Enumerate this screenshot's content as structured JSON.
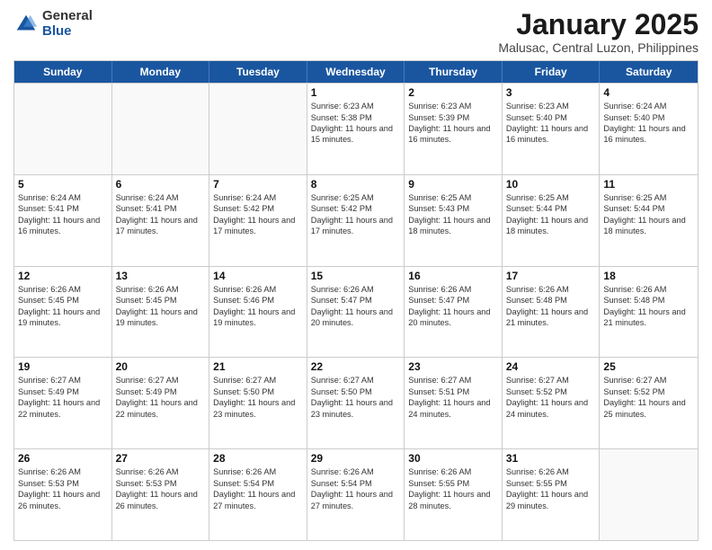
{
  "logo": {
    "general": "General",
    "blue": "Blue"
  },
  "header": {
    "month": "January 2025",
    "location": "Malusac, Central Luzon, Philippines"
  },
  "weekdays": [
    "Sunday",
    "Monday",
    "Tuesday",
    "Wednesday",
    "Thursday",
    "Friday",
    "Saturday"
  ],
  "rows": [
    [
      {
        "day": "",
        "sunrise": "",
        "sunset": "",
        "daylight": "",
        "empty": true
      },
      {
        "day": "",
        "sunrise": "",
        "sunset": "",
        "daylight": "",
        "empty": true
      },
      {
        "day": "",
        "sunrise": "",
        "sunset": "",
        "daylight": "",
        "empty": true
      },
      {
        "day": "1",
        "sunrise": "Sunrise: 6:23 AM",
        "sunset": "Sunset: 5:38 PM",
        "daylight": "Daylight: 11 hours and 15 minutes."
      },
      {
        "day": "2",
        "sunrise": "Sunrise: 6:23 AM",
        "sunset": "Sunset: 5:39 PM",
        "daylight": "Daylight: 11 hours and 16 minutes."
      },
      {
        "day": "3",
        "sunrise": "Sunrise: 6:23 AM",
        "sunset": "Sunset: 5:40 PM",
        "daylight": "Daylight: 11 hours and 16 minutes."
      },
      {
        "day": "4",
        "sunrise": "Sunrise: 6:24 AM",
        "sunset": "Sunset: 5:40 PM",
        "daylight": "Daylight: 11 hours and 16 minutes."
      }
    ],
    [
      {
        "day": "5",
        "sunrise": "Sunrise: 6:24 AM",
        "sunset": "Sunset: 5:41 PM",
        "daylight": "Daylight: 11 hours and 16 minutes."
      },
      {
        "day": "6",
        "sunrise": "Sunrise: 6:24 AM",
        "sunset": "Sunset: 5:41 PM",
        "daylight": "Daylight: 11 hours and 17 minutes."
      },
      {
        "day": "7",
        "sunrise": "Sunrise: 6:24 AM",
        "sunset": "Sunset: 5:42 PM",
        "daylight": "Daylight: 11 hours and 17 minutes."
      },
      {
        "day": "8",
        "sunrise": "Sunrise: 6:25 AM",
        "sunset": "Sunset: 5:42 PM",
        "daylight": "Daylight: 11 hours and 17 minutes."
      },
      {
        "day": "9",
        "sunrise": "Sunrise: 6:25 AM",
        "sunset": "Sunset: 5:43 PM",
        "daylight": "Daylight: 11 hours and 18 minutes."
      },
      {
        "day": "10",
        "sunrise": "Sunrise: 6:25 AM",
        "sunset": "Sunset: 5:44 PM",
        "daylight": "Daylight: 11 hours and 18 minutes."
      },
      {
        "day": "11",
        "sunrise": "Sunrise: 6:25 AM",
        "sunset": "Sunset: 5:44 PM",
        "daylight": "Daylight: 11 hours and 18 minutes."
      }
    ],
    [
      {
        "day": "12",
        "sunrise": "Sunrise: 6:26 AM",
        "sunset": "Sunset: 5:45 PM",
        "daylight": "Daylight: 11 hours and 19 minutes."
      },
      {
        "day": "13",
        "sunrise": "Sunrise: 6:26 AM",
        "sunset": "Sunset: 5:45 PM",
        "daylight": "Daylight: 11 hours and 19 minutes."
      },
      {
        "day": "14",
        "sunrise": "Sunrise: 6:26 AM",
        "sunset": "Sunset: 5:46 PM",
        "daylight": "Daylight: 11 hours and 19 minutes."
      },
      {
        "day": "15",
        "sunrise": "Sunrise: 6:26 AM",
        "sunset": "Sunset: 5:47 PM",
        "daylight": "Daylight: 11 hours and 20 minutes."
      },
      {
        "day": "16",
        "sunrise": "Sunrise: 6:26 AM",
        "sunset": "Sunset: 5:47 PM",
        "daylight": "Daylight: 11 hours and 20 minutes."
      },
      {
        "day": "17",
        "sunrise": "Sunrise: 6:26 AM",
        "sunset": "Sunset: 5:48 PM",
        "daylight": "Daylight: 11 hours and 21 minutes."
      },
      {
        "day": "18",
        "sunrise": "Sunrise: 6:26 AM",
        "sunset": "Sunset: 5:48 PM",
        "daylight": "Daylight: 11 hours and 21 minutes."
      }
    ],
    [
      {
        "day": "19",
        "sunrise": "Sunrise: 6:27 AM",
        "sunset": "Sunset: 5:49 PM",
        "daylight": "Daylight: 11 hours and 22 minutes."
      },
      {
        "day": "20",
        "sunrise": "Sunrise: 6:27 AM",
        "sunset": "Sunset: 5:49 PM",
        "daylight": "Daylight: 11 hours and 22 minutes."
      },
      {
        "day": "21",
        "sunrise": "Sunrise: 6:27 AM",
        "sunset": "Sunset: 5:50 PM",
        "daylight": "Daylight: 11 hours and 23 minutes."
      },
      {
        "day": "22",
        "sunrise": "Sunrise: 6:27 AM",
        "sunset": "Sunset: 5:50 PM",
        "daylight": "Daylight: 11 hours and 23 minutes."
      },
      {
        "day": "23",
        "sunrise": "Sunrise: 6:27 AM",
        "sunset": "Sunset: 5:51 PM",
        "daylight": "Daylight: 11 hours and 24 minutes."
      },
      {
        "day": "24",
        "sunrise": "Sunrise: 6:27 AM",
        "sunset": "Sunset: 5:52 PM",
        "daylight": "Daylight: 11 hours and 24 minutes."
      },
      {
        "day": "25",
        "sunrise": "Sunrise: 6:27 AM",
        "sunset": "Sunset: 5:52 PM",
        "daylight": "Daylight: 11 hours and 25 minutes."
      }
    ],
    [
      {
        "day": "26",
        "sunrise": "Sunrise: 6:26 AM",
        "sunset": "Sunset: 5:53 PM",
        "daylight": "Daylight: 11 hours and 26 minutes."
      },
      {
        "day": "27",
        "sunrise": "Sunrise: 6:26 AM",
        "sunset": "Sunset: 5:53 PM",
        "daylight": "Daylight: 11 hours and 26 minutes."
      },
      {
        "day": "28",
        "sunrise": "Sunrise: 6:26 AM",
        "sunset": "Sunset: 5:54 PM",
        "daylight": "Daylight: 11 hours and 27 minutes."
      },
      {
        "day": "29",
        "sunrise": "Sunrise: 6:26 AM",
        "sunset": "Sunset: 5:54 PM",
        "daylight": "Daylight: 11 hours and 27 minutes."
      },
      {
        "day": "30",
        "sunrise": "Sunrise: 6:26 AM",
        "sunset": "Sunset: 5:55 PM",
        "daylight": "Daylight: 11 hours and 28 minutes."
      },
      {
        "day": "31",
        "sunrise": "Sunrise: 6:26 AM",
        "sunset": "Sunset: 5:55 PM",
        "daylight": "Daylight: 11 hours and 29 minutes."
      },
      {
        "day": "",
        "sunrise": "",
        "sunset": "",
        "daylight": "",
        "empty": true
      }
    ]
  ]
}
